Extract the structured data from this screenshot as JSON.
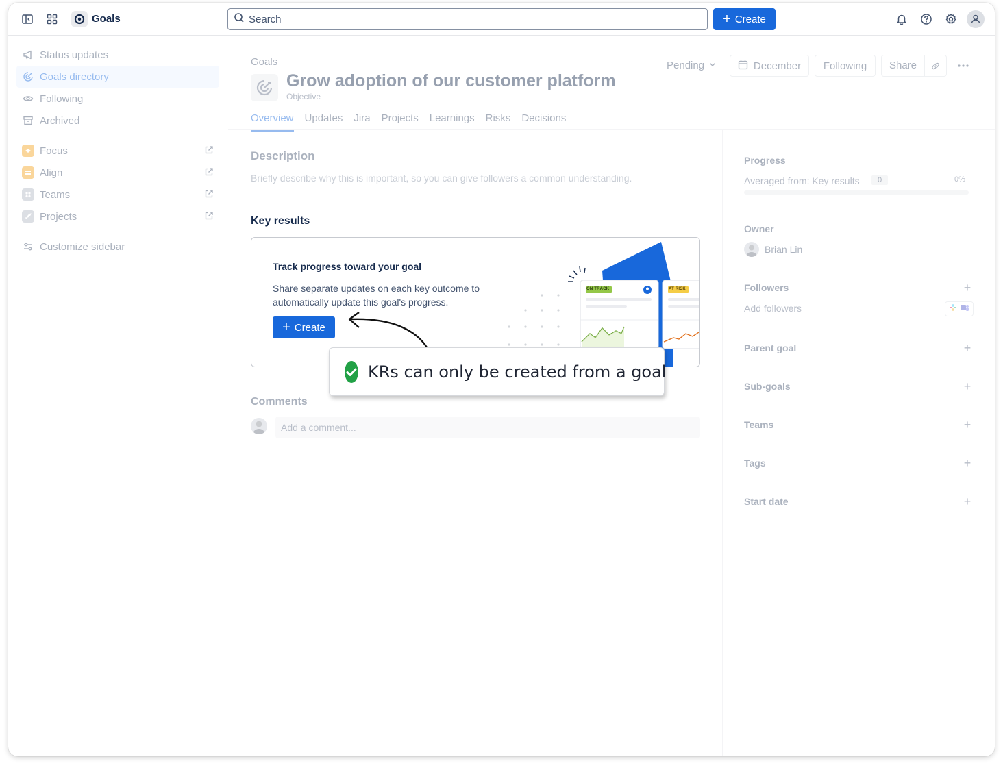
{
  "topbar": {
    "app_name": "Goals",
    "search_placeholder": "Search",
    "create_label": "Create"
  },
  "sidebar": {
    "items": [
      {
        "label": "Status updates",
        "icon": "megaphone-icon"
      },
      {
        "label": "Goals directory",
        "icon": "goal-icon"
      },
      {
        "label": "Following",
        "icon": "eye-icon"
      },
      {
        "label": "Archived",
        "icon": "archive-icon"
      }
    ],
    "apps": [
      {
        "label": "Focus",
        "icon": "focus-icon",
        "color": "#f5a524"
      },
      {
        "label": "Align",
        "icon": "align-icon",
        "color": "#f5a524"
      },
      {
        "label": "Teams",
        "icon": "teams-icon",
        "color": "#b3b9c4"
      },
      {
        "label": "Projects",
        "icon": "rocket-icon",
        "color": "#b3b9c4"
      }
    ],
    "customize_label": "Customize sidebar"
  },
  "goal": {
    "breadcrumb": "Goals",
    "title": "Grow adoption of our customer platform",
    "type": "Objective",
    "status": "Pending",
    "date": "December",
    "following_label": "Following",
    "share_label": "Share",
    "tabs": [
      "Overview",
      "Updates",
      "Jira",
      "Projects",
      "Learnings",
      "Risks",
      "Decisions"
    ]
  },
  "overview": {
    "description_heading": "Description",
    "description_placeholder": "Briefly describe why this is important, so you can give followers a common understanding.",
    "key_results_heading": "Key results",
    "kr_card": {
      "title": "Track progress toward your goal",
      "body": "Share separate updates on each key outcome to automatically update this goal's progress.",
      "create_label": "Create",
      "badge_on_track": "ON TRACK",
      "badge_at_risk": "AT RISK"
    },
    "comments_heading": "Comments",
    "comment_placeholder": "Add a comment..."
  },
  "details": {
    "progress_label": "Progress",
    "averaged_from": "Averaged from: Key results",
    "kr_count": "0",
    "percent": "0%",
    "progress_fraction": 0,
    "owner_label": "Owner",
    "owner_name": "Brian Lin",
    "followers_label": "Followers",
    "add_followers": "Add followers",
    "parent_goal_label": "Parent goal",
    "sub_goals_label": "Sub-goals",
    "teams_label": "Teams",
    "tags_label": "Tags",
    "start_date_label": "Start date"
  },
  "callout": {
    "text": "KRs can only be created from a goal"
  },
  "colors": {
    "accent": "#1868db",
    "success": "#22a146"
  }
}
